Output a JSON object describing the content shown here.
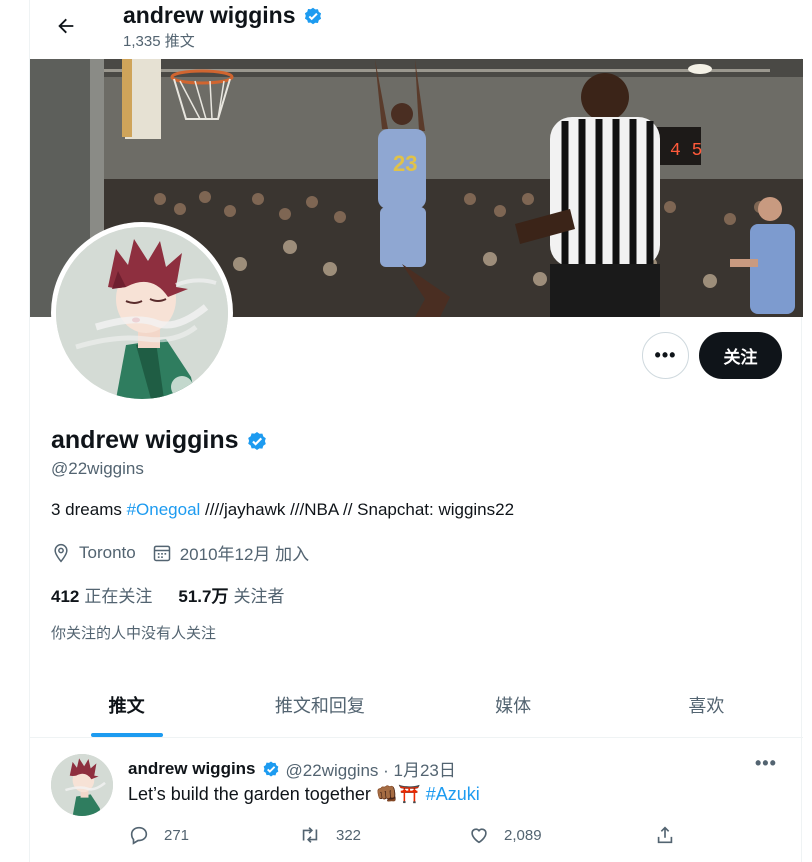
{
  "header": {
    "name": "andrew wiggins",
    "tweet_count": "1,335 推文"
  },
  "profile": {
    "name": "andrew wiggins",
    "handle": "@22wiggins",
    "bio_prefix": "3 dreams ",
    "bio_hashtag": "#Onegoal",
    "bio_suffix": " ////jayhawk ///NBA // Snapchat: wiggins22",
    "location": "Toronto",
    "joined": "2010年12月 加入",
    "following_count": "412",
    "following_label": "正在关注",
    "followers_count": "51.7万",
    "followers_label": "关注者",
    "followers_you_know": "你关注的人中没有人关注",
    "more_label": "•••",
    "follow_label": "关注"
  },
  "tabs": [
    {
      "label": "推文",
      "active": true
    },
    {
      "label": "推文和回复",
      "active": false
    },
    {
      "label": "媒体",
      "active": false
    },
    {
      "label": "喜欢",
      "active": false
    }
  ],
  "tweet": {
    "name": "andrew wiggins",
    "handle_date": "@22wiggins · 1月23日",
    "text": "Let’s build the garden together",
    "emoji": "👊🏾⛩️",
    "hashtag": "#Azuki",
    "more_label": "•••",
    "replies": "271",
    "retweets": "322",
    "likes": "2,089"
  },
  "banner": {
    "scoreboard": "4 5"
  },
  "colors": {
    "accent": "#1d9bf0",
    "text": "#0f1419",
    "muted": "#536471"
  }
}
